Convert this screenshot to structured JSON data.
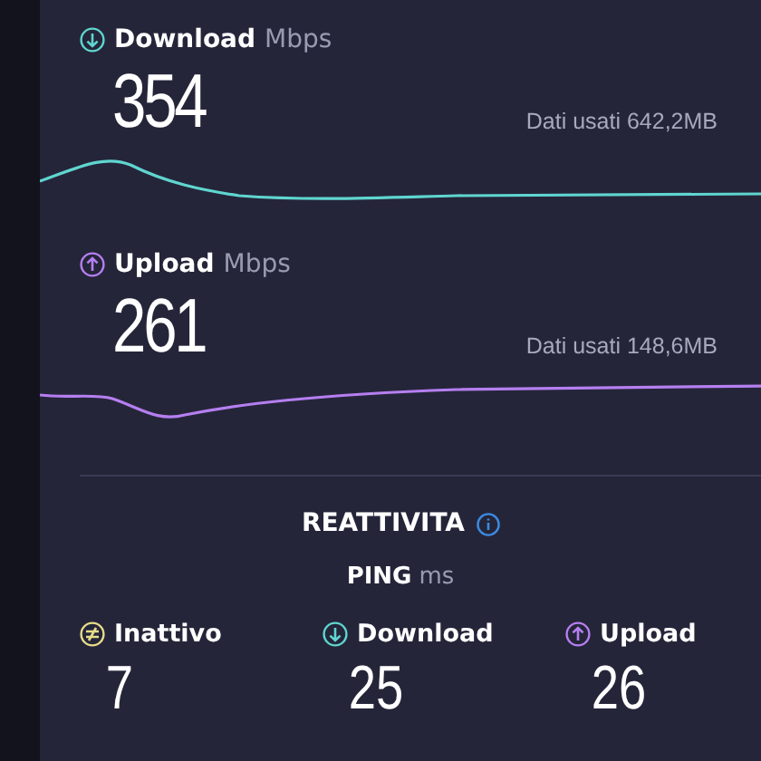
{
  "measurements": [
    {
      "kind": "download",
      "label": "Download",
      "unit": "Mbps",
      "value": "354",
      "data_used": "Dati usati 642,2MB"
    },
    {
      "kind": "upload",
      "label": "Upload",
      "unit": "Mbps",
      "value": "261",
      "data_used": "Dati usati 148,6MB"
    }
  ],
  "responsiveness": {
    "title": "REATTIVITA",
    "ping_label": "PING",
    "ping_unit": "ms",
    "items": [
      {
        "kind": "idle",
        "label": "Inattivo",
        "value": "7"
      },
      {
        "kind": "download",
        "label": "Download",
        "value": "25"
      },
      {
        "kind": "upload",
        "label": "Upload",
        "value": "26"
      }
    ]
  }
}
